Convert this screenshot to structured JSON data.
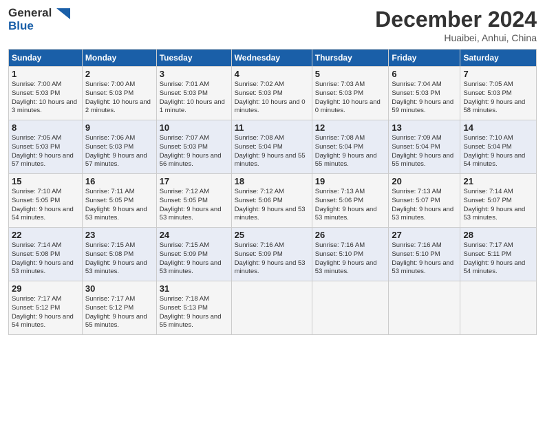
{
  "header": {
    "logo_line1": "General",
    "logo_line2": "Blue",
    "title": "December 2024",
    "location": "Huaibei, Anhui, China"
  },
  "weekdays": [
    "Sunday",
    "Monday",
    "Tuesday",
    "Wednesday",
    "Thursday",
    "Friday",
    "Saturday"
  ],
  "weeks": [
    [
      {
        "day": "1",
        "sunrise": "Sunrise: 7:00 AM",
        "sunset": "Sunset: 5:03 PM",
        "daylight": "Daylight: 10 hours and 3 minutes."
      },
      {
        "day": "2",
        "sunrise": "Sunrise: 7:00 AM",
        "sunset": "Sunset: 5:03 PM",
        "daylight": "Daylight: 10 hours and 2 minutes."
      },
      {
        "day": "3",
        "sunrise": "Sunrise: 7:01 AM",
        "sunset": "Sunset: 5:03 PM",
        "daylight": "Daylight: 10 hours and 1 minute."
      },
      {
        "day": "4",
        "sunrise": "Sunrise: 7:02 AM",
        "sunset": "Sunset: 5:03 PM",
        "daylight": "Daylight: 10 hours and 0 minutes."
      },
      {
        "day": "5",
        "sunrise": "Sunrise: 7:03 AM",
        "sunset": "Sunset: 5:03 PM",
        "daylight": "Daylight: 10 hours and 0 minutes."
      },
      {
        "day": "6",
        "sunrise": "Sunrise: 7:04 AM",
        "sunset": "Sunset: 5:03 PM",
        "daylight": "Daylight: 9 hours and 59 minutes."
      },
      {
        "day": "7",
        "sunrise": "Sunrise: 7:05 AM",
        "sunset": "Sunset: 5:03 PM",
        "daylight": "Daylight: 9 hours and 58 minutes."
      }
    ],
    [
      {
        "day": "8",
        "sunrise": "Sunrise: 7:05 AM",
        "sunset": "Sunset: 5:03 PM",
        "daylight": "Daylight: 9 hours and 57 minutes."
      },
      {
        "day": "9",
        "sunrise": "Sunrise: 7:06 AM",
        "sunset": "Sunset: 5:03 PM",
        "daylight": "Daylight: 9 hours and 57 minutes."
      },
      {
        "day": "10",
        "sunrise": "Sunrise: 7:07 AM",
        "sunset": "Sunset: 5:03 PM",
        "daylight": "Daylight: 9 hours and 56 minutes."
      },
      {
        "day": "11",
        "sunrise": "Sunrise: 7:08 AM",
        "sunset": "Sunset: 5:04 PM",
        "daylight": "Daylight: 9 hours and 55 minutes."
      },
      {
        "day": "12",
        "sunrise": "Sunrise: 7:08 AM",
        "sunset": "Sunset: 5:04 PM",
        "daylight": "Daylight: 9 hours and 55 minutes."
      },
      {
        "day": "13",
        "sunrise": "Sunrise: 7:09 AM",
        "sunset": "Sunset: 5:04 PM",
        "daylight": "Daylight: 9 hours and 55 minutes."
      },
      {
        "day": "14",
        "sunrise": "Sunrise: 7:10 AM",
        "sunset": "Sunset: 5:04 PM",
        "daylight": "Daylight: 9 hours and 54 minutes."
      }
    ],
    [
      {
        "day": "15",
        "sunrise": "Sunrise: 7:10 AM",
        "sunset": "Sunset: 5:05 PM",
        "daylight": "Daylight: 9 hours and 54 minutes."
      },
      {
        "day": "16",
        "sunrise": "Sunrise: 7:11 AM",
        "sunset": "Sunset: 5:05 PM",
        "daylight": "Daylight: 9 hours and 53 minutes."
      },
      {
        "day": "17",
        "sunrise": "Sunrise: 7:12 AM",
        "sunset": "Sunset: 5:05 PM",
        "daylight": "Daylight: 9 hours and 53 minutes."
      },
      {
        "day": "18",
        "sunrise": "Sunrise: 7:12 AM",
        "sunset": "Sunset: 5:06 PM",
        "daylight": "Daylight: 9 hours and 53 minutes."
      },
      {
        "day": "19",
        "sunrise": "Sunrise: 7:13 AM",
        "sunset": "Sunset: 5:06 PM",
        "daylight": "Daylight: 9 hours and 53 minutes."
      },
      {
        "day": "20",
        "sunrise": "Sunrise: 7:13 AM",
        "sunset": "Sunset: 5:07 PM",
        "daylight": "Daylight: 9 hours and 53 minutes."
      },
      {
        "day": "21",
        "sunrise": "Sunrise: 7:14 AM",
        "sunset": "Sunset: 5:07 PM",
        "daylight": "Daylight: 9 hours and 53 minutes."
      }
    ],
    [
      {
        "day": "22",
        "sunrise": "Sunrise: 7:14 AM",
        "sunset": "Sunset: 5:08 PM",
        "daylight": "Daylight: 9 hours and 53 minutes."
      },
      {
        "day": "23",
        "sunrise": "Sunrise: 7:15 AM",
        "sunset": "Sunset: 5:08 PM",
        "daylight": "Daylight: 9 hours and 53 minutes."
      },
      {
        "day": "24",
        "sunrise": "Sunrise: 7:15 AM",
        "sunset": "Sunset: 5:09 PM",
        "daylight": "Daylight: 9 hours and 53 minutes."
      },
      {
        "day": "25",
        "sunrise": "Sunrise: 7:16 AM",
        "sunset": "Sunset: 5:09 PM",
        "daylight": "Daylight: 9 hours and 53 minutes."
      },
      {
        "day": "26",
        "sunrise": "Sunrise: 7:16 AM",
        "sunset": "Sunset: 5:10 PM",
        "daylight": "Daylight: 9 hours and 53 minutes."
      },
      {
        "day": "27",
        "sunrise": "Sunrise: 7:16 AM",
        "sunset": "Sunset: 5:10 PM",
        "daylight": "Daylight: 9 hours and 53 minutes."
      },
      {
        "day": "28",
        "sunrise": "Sunrise: 7:17 AM",
        "sunset": "Sunset: 5:11 PM",
        "daylight": "Daylight: 9 hours and 54 minutes."
      }
    ],
    [
      {
        "day": "29",
        "sunrise": "Sunrise: 7:17 AM",
        "sunset": "Sunset: 5:12 PM",
        "daylight": "Daylight: 9 hours and 54 minutes."
      },
      {
        "day": "30",
        "sunrise": "Sunrise: 7:17 AM",
        "sunset": "Sunset: 5:12 PM",
        "daylight": "Daylight: 9 hours and 55 minutes."
      },
      {
        "day": "31",
        "sunrise": "Sunrise: 7:18 AM",
        "sunset": "Sunset: 5:13 PM",
        "daylight": "Daylight: 9 hours and 55 minutes."
      },
      null,
      null,
      null,
      null
    ]
  ]
}
